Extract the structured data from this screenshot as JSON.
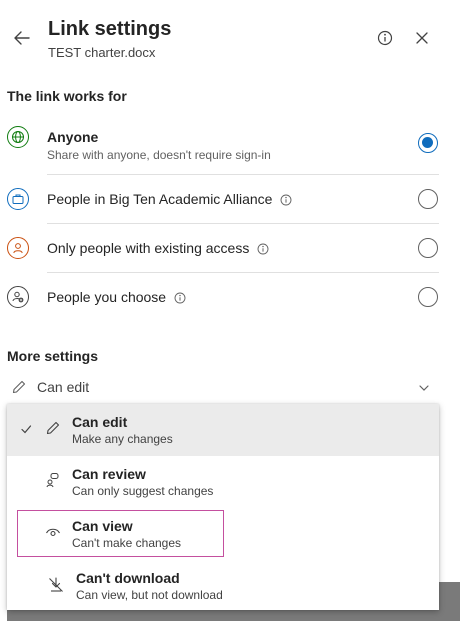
{
  "header": {
    "title": "Link settings",
    "filename": "TEST charter.docx"
  },
  "link_section": {
    "heading": "The link works for",
    "options": [
      {
        "label": "Anyone",
        "description": "Share with anyone, doesn't require sign-in",
        "selected": true,
        "icon": "globe-icon"
      },
      {
        "label": "People in Big Ten Academic Alliance",
        "selected": false,
        "icon": "briefcase-icon",
        "has_info": true
      },
      {
        "label": "Only people with existing access",
        "selected": false,
        "icon": "person-icon",
        "has_info": true
      },
      {
        "label": "People you choose",
        "selected": false,
        "icon": "person-add-icon",
        "has_info": true
      }
    ]
  },
  "more_settings": {
    "heading": "More settings",
    "permission_value": "Can edit"
  },
  "permission_menu": {
    "items": [
      {
        "label": "Can edit",
        "description": "Make any changes",
        "selected": true,
        "icon": "pencil-icon"
      },
      {
        "label": "Can review",
        "description": "Can only suggest changes",
        "selected": false,
        "icon": "review-icon"
      },
      {
        "label": "Can view",
        "description": "Can't make changes",
        "selected": false,
        "icon": "eye-icon",
        "focused": true
      },
      {
        "label": "Can't download",
        "description": "Can view, but not download",
        "selected": false,
        "icon": "no-download-icon"
      }
    ]
  },
  "colors": {
    "accent": "#0f6cbd",
    "focus_outline": "#c44f9f",
    "globe_icon": "#107c10",
    "briefcase_icon": "#0f6cbd",
    "person_icon": "#ca5010"
  }
}
